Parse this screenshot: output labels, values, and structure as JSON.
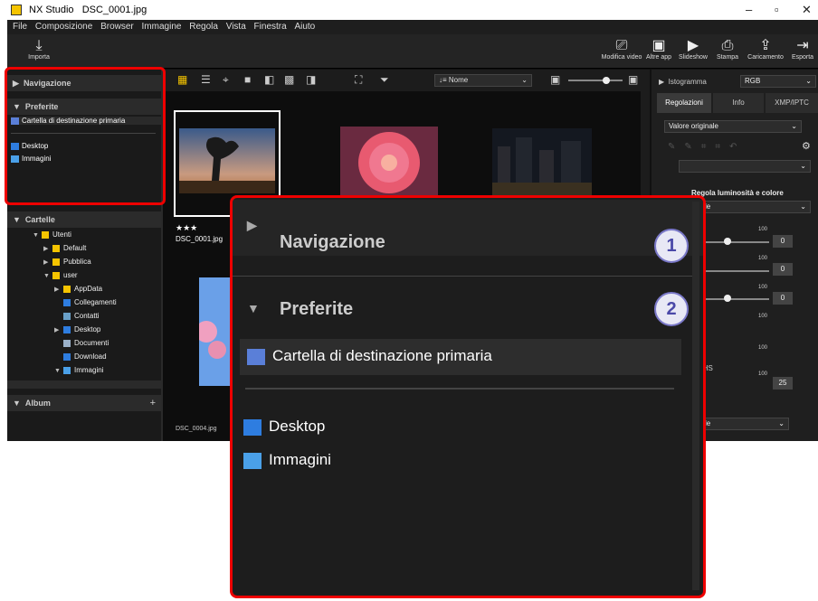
{
  "window": {
    "app": "NX Studio",
    "file": "DSC_0001.jpg"
  },
  "menu": [
    "File",
    "Composizione",
    "Browser",
    "Immagine",
    "Regola",
    "Vista",
    "Finestra",
    "Aiuto"
  ],
  "toolbar": {
    "import": "Importa",
    "modifica_video": "Modifica video",
    "altre_app": "Altre app",
    "slideshow": "Slideshow",
    "stampa": "Stampa",
    "caricamento": "Caricamento",
    "esporta": "Esporta"
  },
  "left": {
    "navigazione": "Navigazione",
    "preferite": "Preferite",
    "favorites": [
      "Cartella di destinazione primaria",
      "Desktop",
      "Immagini"
    ],
    "cartelle": "Cartelle",
    "tree": [
      "Utenti",
      "Default",
      "Pubblica",
      "user",
      "AppData",
      "Collegamenti",
      "Contatti",
      "Desktop",
      "Documenti",
      "Download",
      "Immagini"
    ],
    "album": "Album"
  },
  "browser": {
    "sort": "Nome",
    "thumbs": [
      {
        "stars": "★★★",
        "name": "DSC_0001.jpg"
      },
      {
        "name": "DSC_0004.jpg"
      }
    ]
  },
  "right": {
    "istogramma": "Istogramma",
    "channel": "RGB",
    "tabs": [
      "Regolazioni",
      "Info",
      "XMP/IPTC"
    ],
    "preset": "Valore originale",
    "section": "Regola luminosità e colore",
    "preset2": "originale",
    "values": [
      "0",
      "0",
      "0",
      "25"
    ],
    "preset3": "originale",
    "frags": [
      "à",
      "e",
      "g HS",
      "ve"
    ],
    "max": "100"
  },
  "zoom": {
    "navigazione": "Navigazione",
    "preferite": "Preferite",
    "primary": "Cartella di destinazione primaria",
    "desktop": "Desktop",
    "immagini": "Immagini",
    "badge1": "1",
    "badge2": "2"
  }
}
